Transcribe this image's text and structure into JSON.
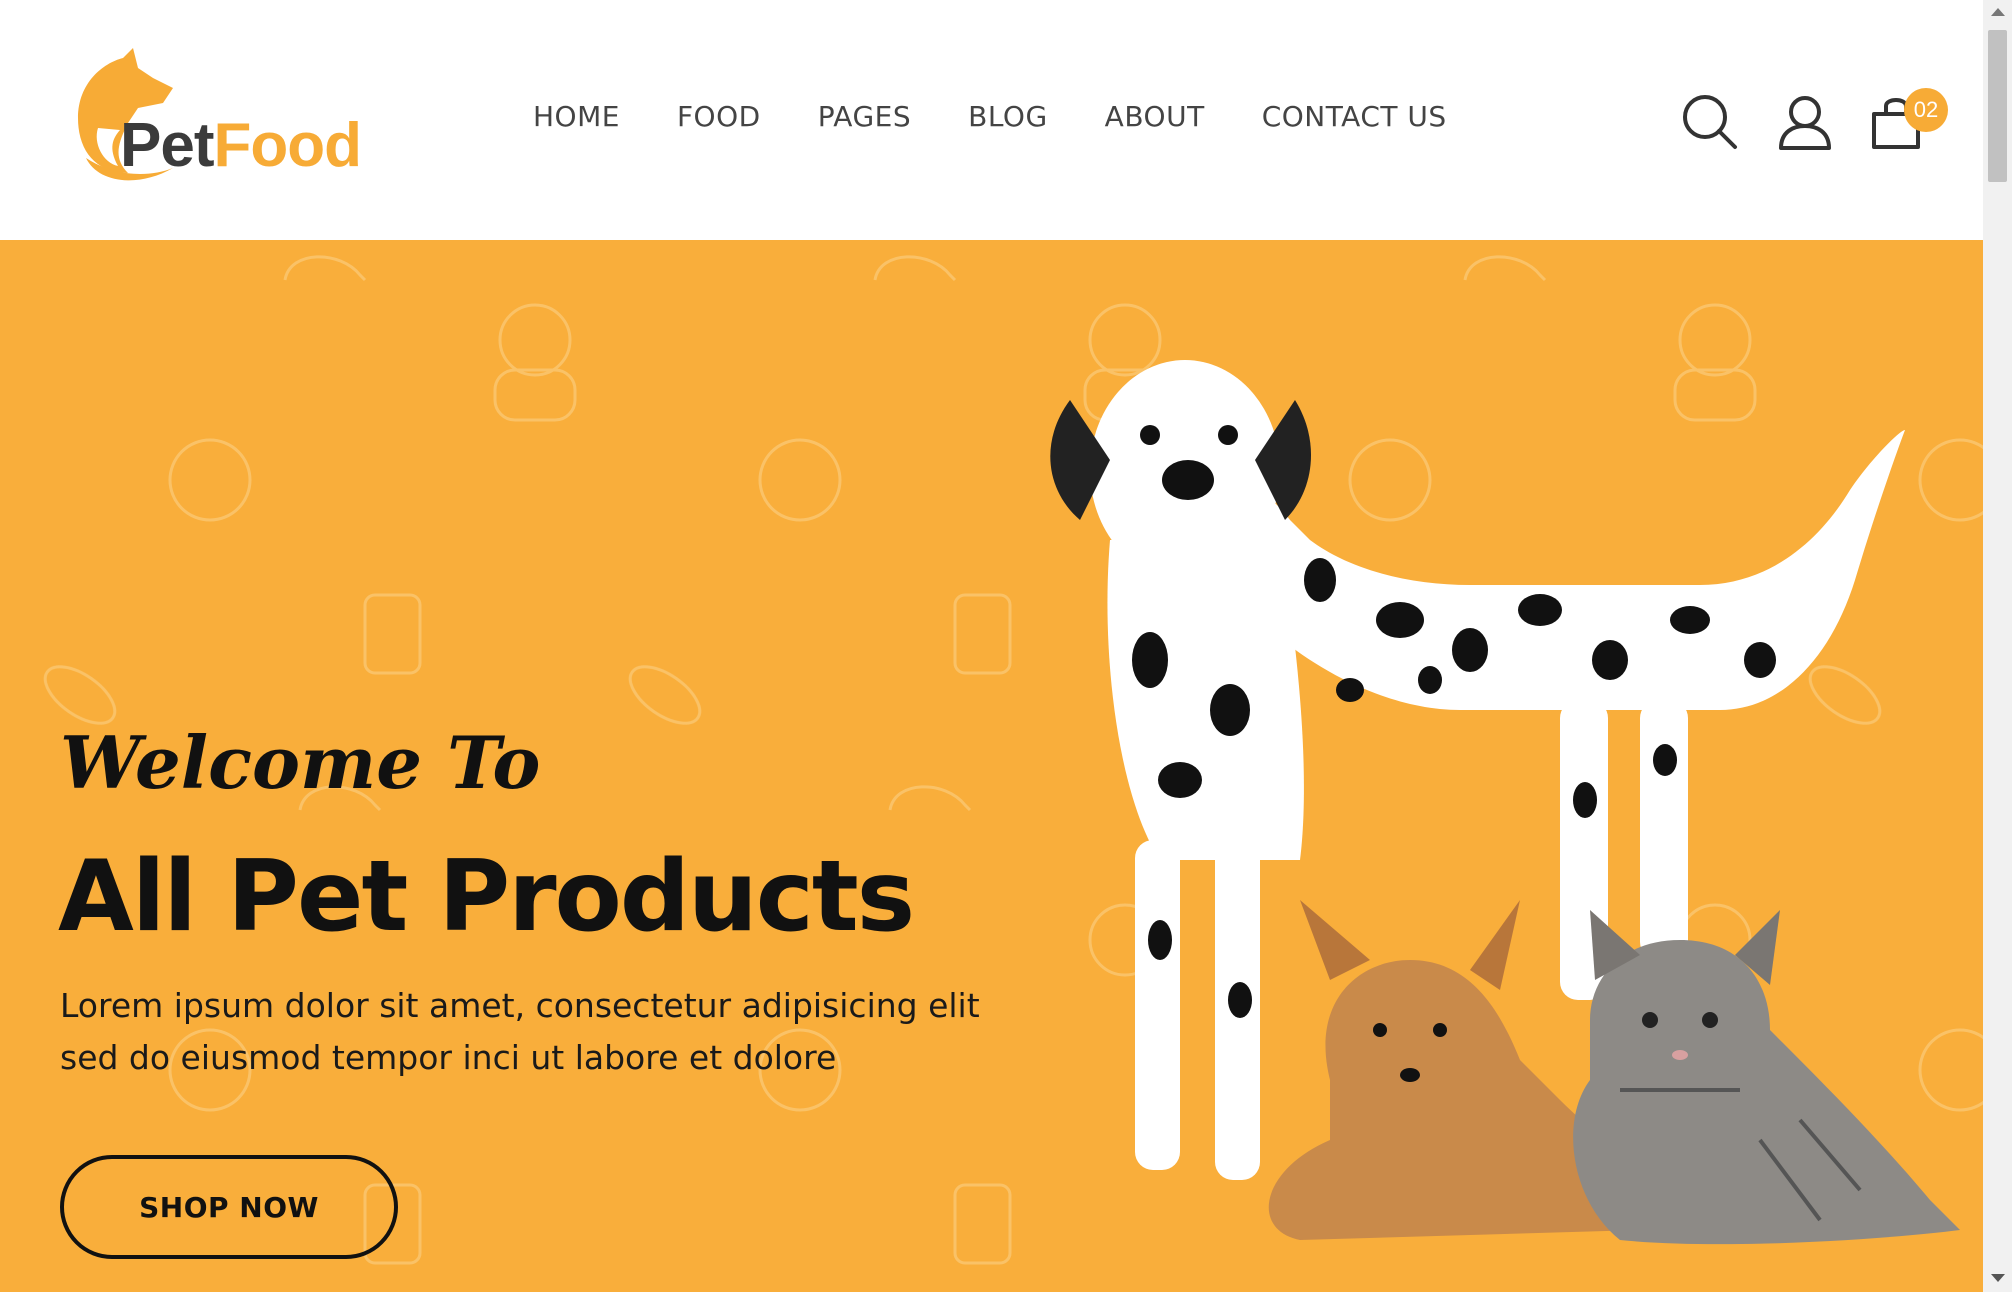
{
  "brand": {
    "logo_text_part1": "Pet",
    "logo_text_part2": "Food",
    "accent_color": "#f9ae3b",
    "icon": "dog-cat-logo-icon"
  },
  "nav": {
    "items": [
      {
        "label": "HOME"
      },
      {
        "label": "FOOD"
      },
      {
        "label": "PAGES"
      },
      {
        "label": "BLOG"
      },
      {
        "label": "ABOUT"
      },
      {
        "label": "CONTACT US"
      }
    ]
  },
  "header_icons": {
    "search": "search-icon",
    "account": "user-icon",
    "cart": "shopping-bag-icon",
    "cart_count": "02"
  },
  "hero": {
    "welcome": "Welcome To",
    "headline": "All Pet Products",
    "description": "Lorem ipsum dolor sit amet, consectetur adipisicing elit sed do eiusmod tempor inci ut labore et dolore",
    "cta_label": "SHOP NOW",
    "background_color": "#f9ae3b",
    "image": "dalmatian-chihuahua-kitten-photo"
  }
}
